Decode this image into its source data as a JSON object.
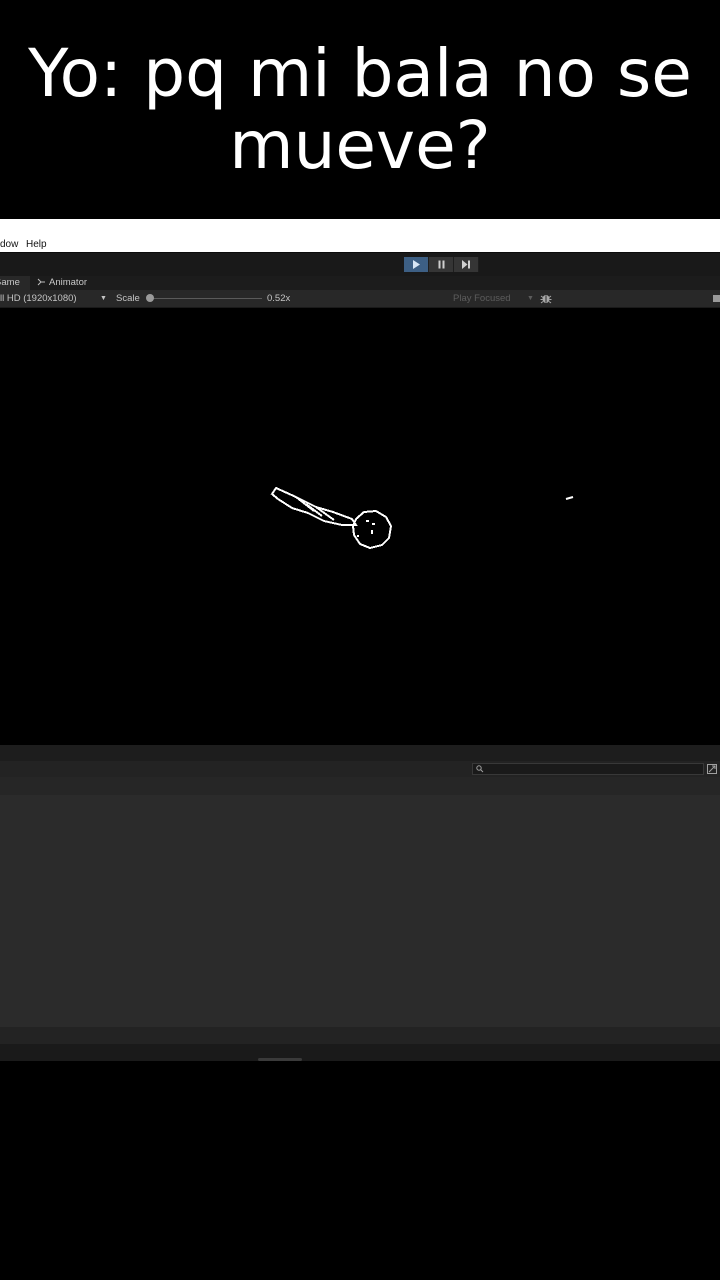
{
  "caption": {
    "line1": "Yo: pq mi bala no se",
    "line2": "mueve?"
  },
  "menu": {
    "items": [
      "dow",
      "Help"
    ]
  },
  "playmode": {
    "play_icon": "play-icon",
    "pause_icon": "pause-icon",
    "step_icon": "step-icon",
    "play_active_color": "#3d5f84"
  },
  "tabs": {
    "game": "Game",
    "animator": "Animator",
    "animator_icon": "animator-icon"
  },
  "game_toolbar": {
    "resolution": "ll HD (1920x1080)",
    "scale_label": "Scale",
    "scale_value": "0.52x",
    "scale_fraction": 0.0,
    "play_focused": "Play Focused",
    "bug_icon": "bug-icon"
  },
  "console": {
    "search_icon": "search-icon",
    "collapse_icon": "window-icon"
  },
  "scene": {
    "sprite_color": "#ffffff"
  }
}
